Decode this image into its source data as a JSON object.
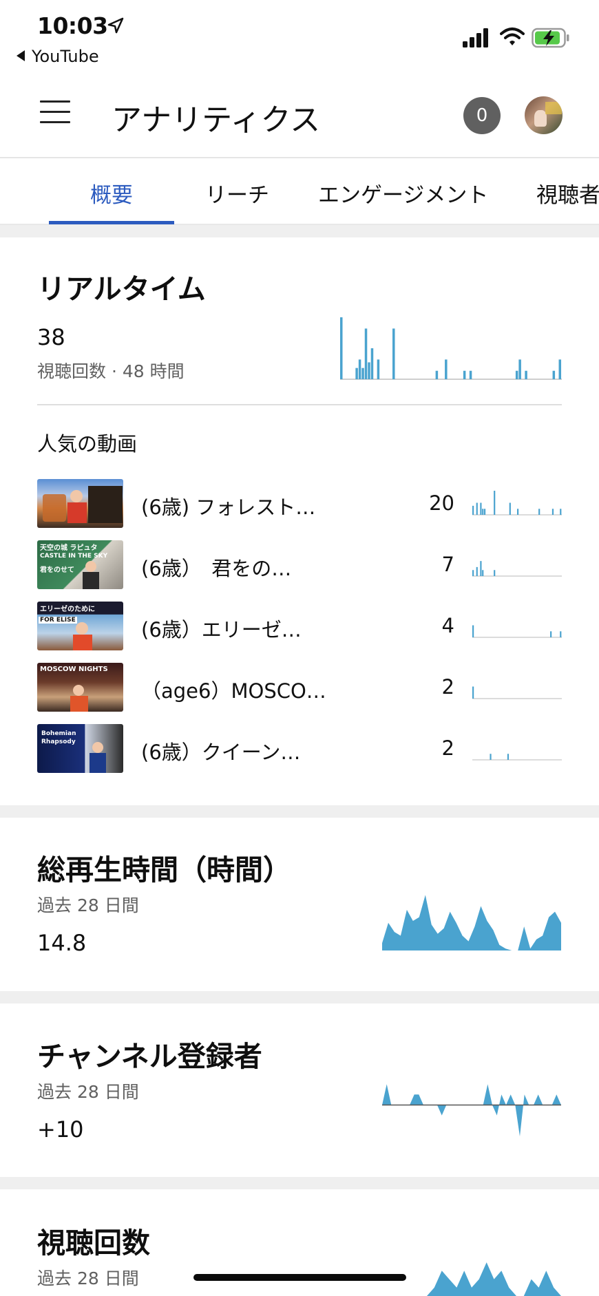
{
  "status_bar": {
    "time": "10:03",
    "back_app": "YouTube"
  },
  "header": {
    "title": "アナリティクス",
    "notification_count": "0"
  },
  "tabs": [
    {
      "label": "概要",
      "active": true
    },
    {
      "label": "リーチ",
      "active": false
    },
    {
      "label": "エンゲージメント",
      "active": false
    },
    {
      "label": "視聴者",
      "active": false
    }
  ],
  "realtime": {
    "title": "リアルタイム",
    "views": "38",
    "caption": "視聴回数 · 48 時間",
    "popular_label": "人気の動画",
    "videos": [
      {
        "title": "(6歳) フォレスト…",
        "count": "20"
      },
      {
        "title": "(6歳）　君をの…",
        "count": "7"
      },
      {
        "title": "(6歳）エリーゼ…",
        "count": "4"
      },
      {
        "title": "（age6）MOSCO…",
        "count": "2"
      },
      {
        "title": "(6歳）クイーン…",
        "count": "2"
      }
    ],
    "thumb_texts": {
      "v2_top": "天空の城 ラピュタ",
      "v2_mid": "CASTLE IN THE SKY",
      "v2_low": "君をのせて",
      "v3_top": "エリーゼのために",
      "v3_mid": "FOR ELISE",
      "v4_top": "MOSCOW NIGHTS",
      "v5_top": "Bohemian Rhapsody"
    }
  },
  "watch_time": {
    "title": "総再生時間（時間）",
    "period": "過去 28 日間",
    "value": "14.8"
  },
  "subscribers": {
    "title": "チャンネル登録者",
    "period": "過去 28 日間",
    "value": "+10"
  },
  "views": {
    "title": "視聴回数",
    "period": "過去 28 日間"
  },
  "colors": {
    "accent_blue": "#2c5bbf",
    "chart_blue": "#4aa3cf",
    "badge_gray": "#606060"
  },
  "chart_data": [
    {
      "type": "bar",
      "name": "realtime-48h",
      "values": [
        22,
        0,
        0,
        0,
        0,
        4,
        7,
        4,
        18,
        6,
        11,
        0,
        7,
        0,
        0,
        0,
        0,
        18,
        0,
        0,
        0,
        0,
        0,
        0,
        0,
        0,
        0,
        0,
        0,
        0,
        0,
        3,
        0,
        0,
        7,
        0,
        0,
        0,
        0,
        0,
        3,
        0,
        3,
        0,
        0,
        0,
        0,
        0,
        0,
        0,
        0,
        0,
        0,
        0,
        0,
        0,
        0,
        3,
        7,
        0,
        3,
        0,
        0,
        0,
        0,
        0,
        0,
        0,
        0,
        3,
        0,
        7
      ]
    },
    {
      "type": "bar",
      "name": "video-1",
      "values": [
        3,
        0,
        4,
        0,
        4,
        2,
        2,
        0,
        0,
        0,
        0,
        8,
        0,
        0,
        0,
        0,
        0,
        0,
        0,
        4,
        0,
        0,
        0,
        2,
        0,
        0,
        0,
        0,
        0,
        0,
        0,
        0,
        0,
        0,
        2,
        0,
        0,
        0,
        0,
        0,
        0,
        2,
        0,
        0,
        0,
        2
      ]
    },
    {
      "type": "bar",
      "name": "video-2",
      "values": [
        2,
        0,
        3,
        0,
        5,
        2,
        0,
        0,
        0,
        0,
        0,
        2,
        0,
        0,
        0,
        0,
        0,
        0,
        0,
        0,
        0,
        0,
        0,
        0,
        0,
        0,
        0,
        0,
        0,
        0,
        0,
        0,
        0,
        0,
        0,
        0,
        0,
        0,
        0,
        0,
        0,
        0,
        0,
        0,
        0,
        0
      ]
    },
    {
      "type": "bar",
      "name": "video-3",
      "values": [
        4,
        0,
        0,
        0,
        0,
        0,
        0,
        0,
        0,
        0,
        0,
        0,
        0,
        0,
        0,
        0,
        0,
        0,
        0,
        0,
        0,
        0,
        0,
        0,
        0,
        0,
        0,
        0,
        0,
        0,
        0,
        0,
        0,
        0,
        0,
        0,
        0,
        0,
        0,
        0,
        2,
        0,
        0,
        0,
        0,
        2
      ]
    },
    {
      "type": "bar",
      "name": "video-4",
      "values": [
        4,
        0,
        0,
        0,
        0,
        0,
        0,
        0,
        0,
        0,
        0,
        0,
        0,
        0,
        0,
        0,
        0,
        0,
        0,
        0,
        0,
        0,
        0,
        0,
        0,
        0,
        0,
        0,
        0,
        0,
        0,
        0,
        0,
        0,
        0,
        0,
        0,
        0,
        0,
        0,
        0,
        0,
        0,
        0,
        0,
        0
      ]
    },
    {
      "type": "bar",
      "name": "video-5",
      "values": [
        0,
        0,
        0,
        0,
        0,
        0,
        0,
        0,
        0,
        2,
        0,
        0,
        0,
        0,
        0,
        0,
        0,
        0,
        2,
        0,
        0,
        0,
        0,
        0,
        0,
        0,
        0,
        0,
        0,
        0,
        0,
        0,
        0,
        0,
        0,
        0,
        0,
        0,
        0,
        0,
        0,
        0,
        0,
        0,
        0,
        0
      ]
    },
    {
      "type": "area",
      "name": "watch-time-28d",
      "values": [
        0.4,
        1.5,
        1.0,
        0.8,
        2.2,
        1.6,
        1.8,
        3.0,
        1.4,
        0.9,
        1.2,
        2.1,
        1.5,
        0.8,
        0.5,
        1.3,
        2.4,
        1.6,
        1.1,
        0.3,
        0.1,
        0.0,
        0.0,
        1.3,
        0.1,
        0.6,
        0.8,
        1.8,
        2.1,
        1.5
      ]
    },
    {
      "type": "area",
      "name": "subscribers-28d",
      "values": [
        0,
        2,
        0,
        0,
        0,
        0,
        0,
        1,
        1,
        0,
        0,
        0,
        0,
        -1,
        0,
        0,
        0,
        0,
        0,
        0,
        0,
        0,
        0,
        2,
        0,
        -1,
        1,
        0,
        1,
        0,
        -3,
        1,
        0,
        0,
        1,
        0,
        0,
        0,
        1,
        0
      ]
    },
    {
      "type": "area",
      "name": "views-28d",
      "values": [
        0,
        0,
        0,
        0,
        0,
        0,
        0,
        1,
        3,
        2,
        1,
        3,
        1,
        2,
        4,
        2,
        3,
        1,
        0,
        0,
        2,
        1,
        3,
        1,
        0
      ]
    }
  ]
}
